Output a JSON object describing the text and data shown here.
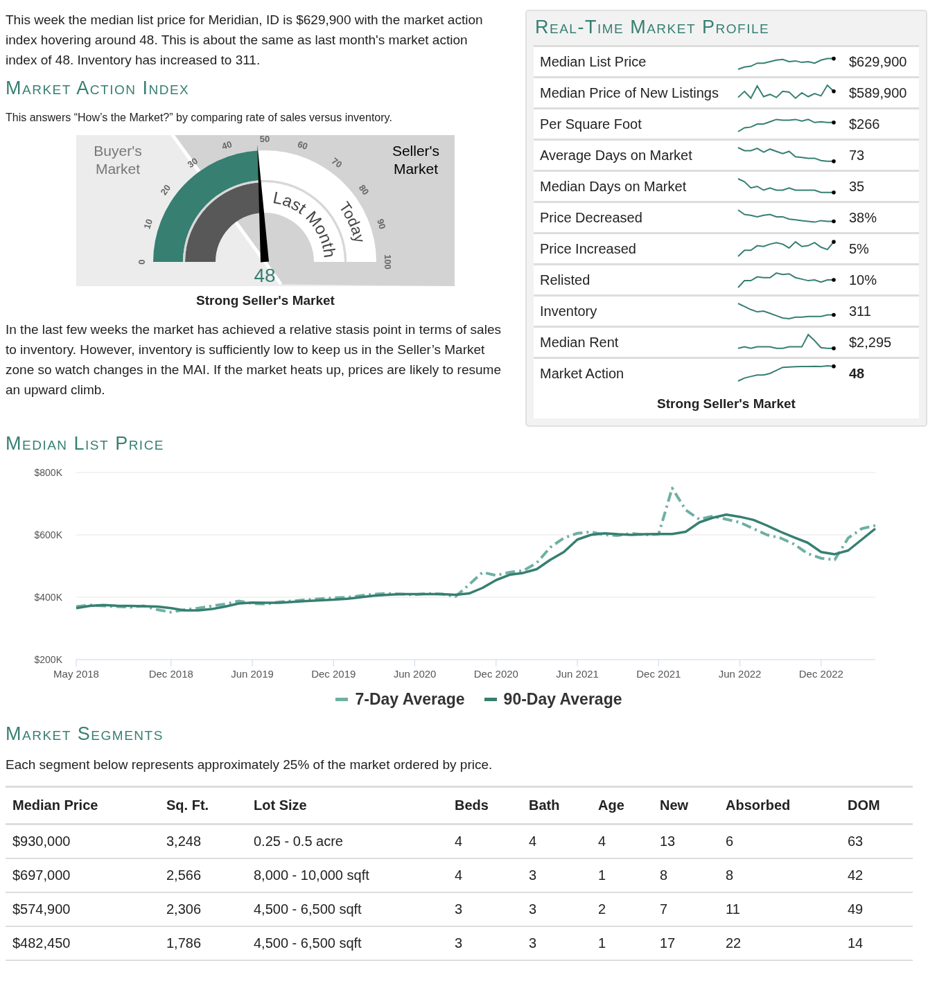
{
  "intro": "This week the median list price for Meridian, ID is $629,900 with the market action index hovering around 48. This is about the same as last month's market action index of 48. Inventory has increased to 311.",
  "market_action_index": {
    "title": "Market Action Index",
    "subtitle": "This answers “How’s the Market?” by comparing rate of sales versus inventory.",
    "gauge": {
      "buyers_label": "Buyer's Market",
      "sellers_label": "Seller's Market",
      "ticks": [
        "0",
        "10",
        "20",
        "30",
        "40",
        "50",
        "60",
        "70",
        "80",
        "90",
        "100"
      ],
      "rings": [
        {
          "label": "Last Month",
          "level": 0.48
        },
        {
          "label": "Today",
          "level": 0.48
        }
      ],
      "reading": "48"
    },
    "verdict": "Strong Seller's Market",
    "summary": "In the last few weeks the market has achieved a relative stasis point in terms of sales to inventory. However, inventory is sufficiently low to keep us in the Seller’s Market zone so watch changes in the MAI. If the market heats up, prices are likely to resume an upward climb."
  },
  "market_profile": {
    "title": "Real-Time Market Profile",
    "rows": [
      {
        "label": "Median List Price",
        "value": "$629,900",
        "emphasis": false
      },
      {
        "label": "Median Price of New Listings",
        "value": "$589,900",
        "emphasis": false
      },
      {
        "label": "Per Square Foot",
        "value": "$266",
        "emphasis": false
      },
      {
        "label": "Average Days on Market",
        "value": "73",
        "emphasis": false
      },
      {
        "label": "Median Days on Market",
        "value": "35",
        "emphasis": false
      },
      {
        "label": "Price Decreased",
        "value": "38%",
        "emphasis": false
      },
      {
        "label": "Price Increased",
        "value": "5%",
        "emphasis": false
      },
      {
        "label": "Relisted",
        "value": "10%",
        "emphasis": false
      },
      {
        "label": "Inventory",
        "value": "311",
        "emphasis": false
      },
      {
        "label": "Median Rent",
        "value": "$2,295",
        "emphasis": false
      },
      {
        "label": "Market Action",
        "value": "48",
        "emphasis": true
      }
    ],
    "verdict": "Strong Seller's Market"
  },
  "median_list_price": {
    "title": "Median List Price",
    "chart_data": {
      "type": "line",
      "x": [
        "2018-05",
        "2018-06",
        "2018-07",
        "2018-08",
        "2018-09",
        "2018-10",
        "2018-11",
        "2018-12",
        "2019-01",
        "2019-02",
        "2019-03",
        "2019-04",
        "2019-05",
        "2019-06",
        "2019-07",
        "2019-08",
        "2019-09",
        "2019-10",
        "2019-11",
        "2019-12",
        "2020-01",
        "2020-02",
        "2020-03",
        "2020-04",
        "2020-05",
        "2020-06",
        "2020-07",
        "2020-08",
        "2020-09",
        "2020-10",
        "2020-11",
        "2020-12",
        "2021-01",
        "2021-02",
        "2021-03",
        "2021-04",
        "2021-05",
        "2021-06",
        "2021-07",
        "2021-08",
        "2021-09",
        "2021-10",
        "2021-11",
        "2021-12",
        "2022-01",
        "2022-02",
        "2022-03",
        "2022-04",
        "2022-05",
        "2022-06",
        "2022-07",
        "2022-08",
        "2022-09",
        "2022-10",
        "2022-11",
        "2022-12",
        "2023-01",
        "2023-02",
        "2023-03",
        "2023-04"
      ],
      "series": [
        {
          "name": "7-Day Average",
          "color": "#6fb0a3",
          "line_style": "dashed",
          "values": [
            370000,
            375000,
            372000,
            370000,
            368000,
            372000,
            360000,
            352000,
            360000,
            365000,
            372000,
            378000,
            388000,
            380000,
            378000,
            385000,
            388000,
            392000,
            395000,
            398000,
            400000,
            405000,
            410000,
            412000,
            410000,
            408000,
            412000,
            410000,
            402000,
            440000,
            480000,
            470000,
            480000,
            485000,
            510000,
            560000,
            590000,
            605000,
            610000,
            600000,
            598000,
            605000,
            600000,
            602000,
            750000,
            680000,
            650000,
            660000,
            650000,
            640000,
            620000,
            600000,
            590000,
            570000,
            540000,
            525000,
            520000,
            590000,
            620000,
            630000
          ]
        },
        {
          "name": "90-Day Average",
          "color": "#367f71",
          "line_style": "solid",
          "values": [
            365000,
            372000,
            375000,
            373000,
            372000,
            371000,
            370000,
            365000,
            358000,
            358000,
            362000,
            370000,
            380000,
            383000,
            382000,
            382000,
            385000,
            388000,
            390000,
            392000,
            395000,
            400000,
            405000,
            408000,
            410000,
            410000,
            410000,
            410000,
            408000,
            412000,
            430000,
            455000,
            472000,
            478000,
            490000,
            520000,
            545000,
            585000,
            600000,
            605000,
            602000,
            600000,
            602000,
            603000,
            603000,
            610000,
            640000,
            655000,
            665000,
            658000,
            648000,
            630000,
            610000,
            592000,
            575000,
            545000,
            538000,
            550000,
            585000,
            620000
          ]
        }
      ],
      "xlim": [
        "2018-05",
        "2023-04"
      ],
      "ylim": [
        200000,
        800000
      ],
      "yticks": [
        {
          "value": 200000,
          "label": "$200K"
        },
        {
          "value": 400000,
          "label": "$400K"
        },
        {
          "value": 600000,
          "label": "$600K"
        },
        {
          "value": 800000,
          "label": "$800K"
        }
      ],
      "xticks": [
        {
          "value": "2018-05",
          "label": "May 2018"
        },
        {
          "value": "2018-12",
          "label": "Dec 2018"
        },
        {
          "value": "2019-06",
          "label": "Jun 2019"
        },
        {
          "value": "2019-12",
          "label": "Dec 2019"
        },
        {
          "value": "2020-06",
          "label": "Jun 2020"
        },
        {
          "value": "2020-12",
          "label": "Dec 2020"
        },
        {
          "value": "2021-06",
          "label": "Jun 2021"
        },
        {
          "value": "2021-12",
          "label": "Dec 2021"
        },
        {
          "value": "2022-06",
          "label": "Jun 2022"
        },
        {
          "value": "2022-12",
          "label": "Dec 2022"
        }
      ]
    }
  },
  "market_segments": {
    "title": "Market Segments",
    "description": "Each segment below represents approximately 25% of the market ordered by price.",
    "columns": [
      "Median Price",
      "Sq. Ft.",
      "Lot Size",
      "Beds",
      "Bath",
      "Age",
      "New",
      "Absorbed",
      "DOM"
    ],
    "rows": [
      [
        "$930,000",
        "3,248",
        "0.25 - 0.5 acre",
        "4",
        "4",
        "4",
        "13",
        "6",
        "63"
      ],
      [
        "$697,000",
        "2,566",
        "8,000 - 10,000 sqft",
        "4",
        "3",
        "1",
        "8",
        "8",
        "42"
      ],
      [
        "$574,900",
        "2,306",
        "4,500 - 6,500 sqft",
        "3",
        "3",
        "2",
        "7",
        "11",
        "49"
      ],
      [
        "$482,450",
        "1,786",
        "4,500 - 6,500 sqft",
        "3",
        "3",
        "1",
        "17",
        "22",
        "14"
      ]
    ]
  }
}
